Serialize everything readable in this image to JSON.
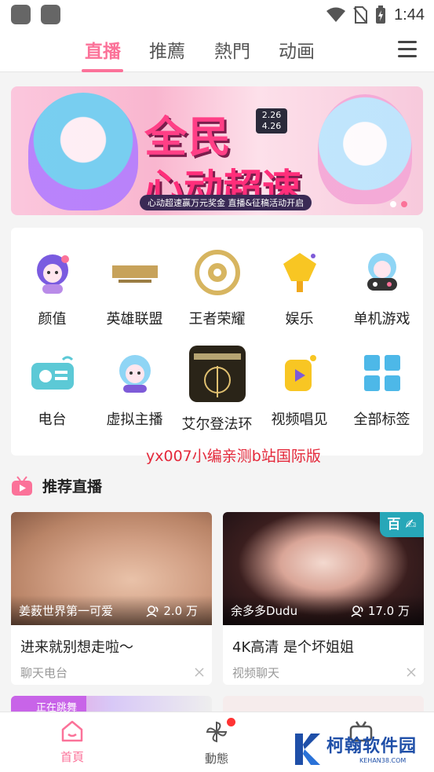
{
  "status_bar": {
    "time": "1:44"
  },
  "top_tabs": [
    {
      "label": "直播",
      "active": true
    },
    {
      "label": "推薦",
      "active": false
    },
    {
      "label": "熱門",
      "active": false
    },
    {
      "label": "动画",
      "active": false
    }
  ],
  "banner": {
    "title": "全民",
    "subtitle": "心动超速",
    "date": "2.26\n4.26",
    "caption": "心动超速赢万元奖金 直播&征稿活动开启"
  },
  "categories": [
    {
      "label": "颜值",
      "icon": "anime-girl-icon"
    },
    {
      "label": "英雄联盟",
      "icon": "league-of-legends-logo-icon"
    },
    {
      "label": "王者荣耀",
      "icon": "honor-of-kings-logo-icon"
    },
    {
      "label": "娱乐",
      "icon": "microphone-icon"
    },
    {
      "label": "单机游戏",
      "icon": "gamepad-girl-icon"
    },
    {
      "label": "电台",
      "icon": "radio-icon"
    },
    {
      "label": "虚拟主播",
      "icon": "vtuber-icon"
    },
    {
      "label": "艾尔登法环",
      "icon": "elden-ring-icon"
    },
    {
      "label": "视频唱见",
      "icon": "sing-mic-icon"
    },
    {
      "label": "全部标签",
      "icon": "grid-tags-icon"
    }
  ],
  "overlay_watermark": "yx007小编亲测b站国际版",
  "section": {
    "title": "推荐直播"
  },
  "cards": [
    {
      "streamer": "姜薮世界第一可爱",
      "viewers": "2.0 万",
      "title": "进来就别想走啦～",
      "tag": "聊天电台",
      "badge": ""
    },
    {
      "streamer": "余多多Dudu",
      "viewers": "17.0 万",
      "title": "4K高清 是个坏姐姐",
      "tag": "视频聊天",
      "badge": "百"
    }
  ],
  "peek_cards": [
    {
      "badge": "正在跳舞"
    },
    {
      "badge": ""
    }
  ],
  "bottom_nav": [
    {
      "label": "首頁",
      "active": true
    },
    {
      "label": "動態",
      "active": false
    }
  ],
  "site_watermark": {
    "name": "柯翰软件园",
    "url": "KEHAN38.COM"
  },
  "colors": {
    "accent": "#fb7299",
    "badge_teal": "#27a7b8"
  }
}
